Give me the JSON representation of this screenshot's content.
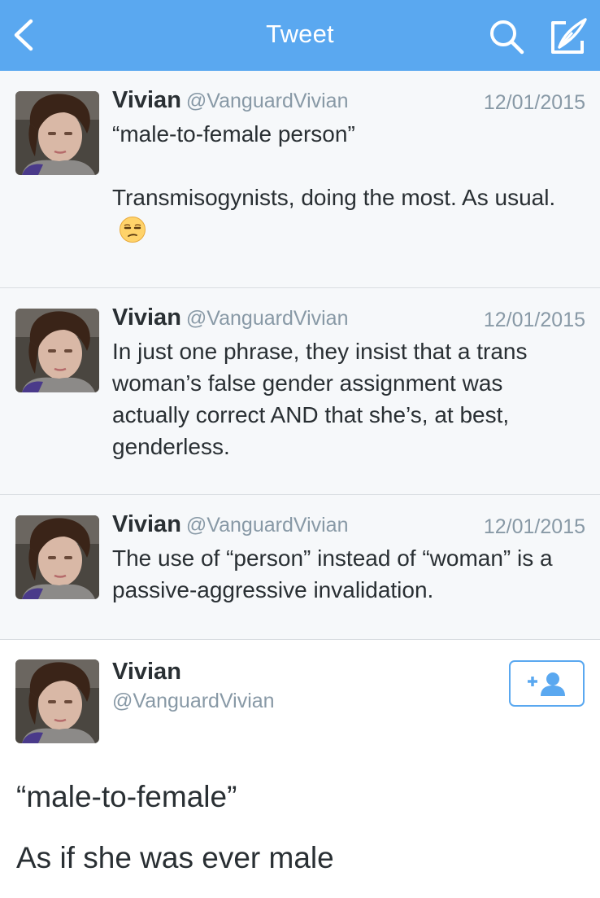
{
  "nav": {
    "title": "Tweet",
    "back_icon": "chevron-left-icon",
    "search_icon": "search-icon",
    "compose_icon": "compose-tweet-icon",
    "bar_color": "#5aa8f0"
  },
  "conversation": [
    {
      "name": "Vivian",
      "handle": "@VanguardVivian",
      "date": "12/01/2015",
      "text_lines": [
        "“male-to-female person”",
        "Transmisogynists, doing the most. As usual."
      ],
      "emoji": "unamused-face-emoji"
    },
    {
      "name": "Vivian",
      "handle": "@VanguardVivian",
      "date": "12/01/2015",
      "text": "In just one phrase, they insist that a trans woman’s false gender assignment was actually correct AND that she’s, at best, genderless."
    },
    {
      "name": "Vivian",
      "handle": "@VanguardVivian",
      "date": "12/01/2015",
      "text": "The use of “person” instead of “woman” is a passive-aggressive invalidation."
    }
  ],
  "main_tweet": {
    "name": "Vivian",
    "handle": "@VanguardVivian",
    "follow_icon": "follow-user-icon",
    "text_lines": [
      "“male-to-female”",
      "As if she was ever male"
    ]
  },
  "colors": {
    "accent": "#5aa8f0",
    "secondary_text": "#8899a6",
    "primary_text": "#292f33",
    "convo_background": "#f6f8fa"
  }
}
